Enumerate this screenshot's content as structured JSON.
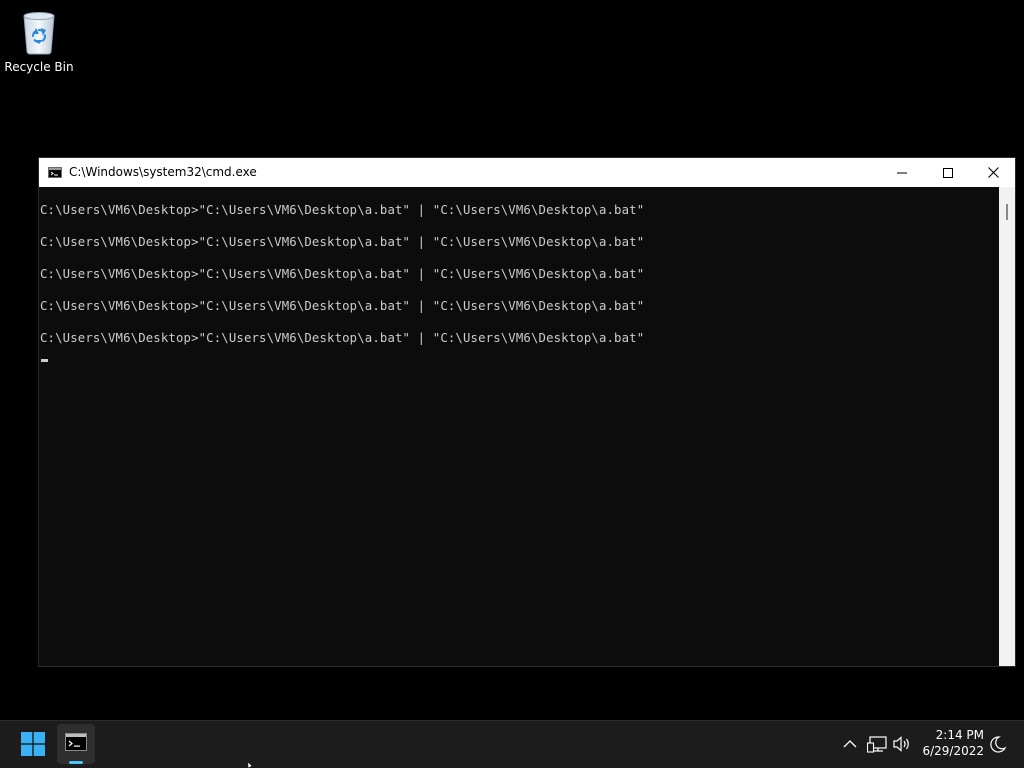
{
  "desktop": {
    "icons": [
      {
        "label": "Recycle Bin",
        "icon": "recycle-bin-icon"
      }
    ]
  },
  "window": {
    "title": "C:\\Windows\\system32\\cmd.exe",
    "icon": "console-icon",
    "controls": {
      "minimize": "minimize-icon",
      "maximize": "maximize-icon",
      "close": "close-icon"
    }
  },
  "console": {
    "lines": [
      "C:\\Users\\VM6\\Desktop>\"C:\\Users\\VM6\\Desktop\\a.bat\" | \"C:\\Users\\VM6\\Desktop\\a.bat\"",
      "C:\\Users\\VM6\\Desktop>\"C:\\Users\\VM6\\Desktop\\a.bat\" | \"C:\\Users\\VM6\\Desktop\\a.bat\"",
      "C:\\Users\\VM6\\Desktop>\"C:\\Users\\VM6\\Desktop\\a.bat\" | \"C:\\Users\\VM6\\Desktop\\a.bat\"",
      "C:\\Users\\VM6\\Desktop>\"C:\\Users\\VM6\\Desktop\\a.bat\" | \"C:\\Users\\VM6\\Desktop\\a.bat\"",
      "C:\\Users\\VM6\\Desktop>\"C:\\Users\\VM6\\Desktop\\a.bat\" | \"C:\\Users\\VM6\\Desktop\\a.bat\""
    ],
    "text_color": "#cccccc",
    "background": "#0c0c0c"
  },
  "taskbar": {
    "start_icon": "windows-start-icon",
    "apps": [
      {
        "name": "cmd",
        "icon": "console-icon",
        "active": true
      }
    ],
    "tray": {
      "chevron_icon": "chevron-up-icon",
      "network_icon": "network-icon",
      "volume_icon": "volume-icon",
      "notification_icon": "notification-moon-icon"
    },
    "clock": {
      "time": "2:14 PM",
      "date": "6/29/2022"
    },
    "accent": "#4cc2ff"
  }
}
